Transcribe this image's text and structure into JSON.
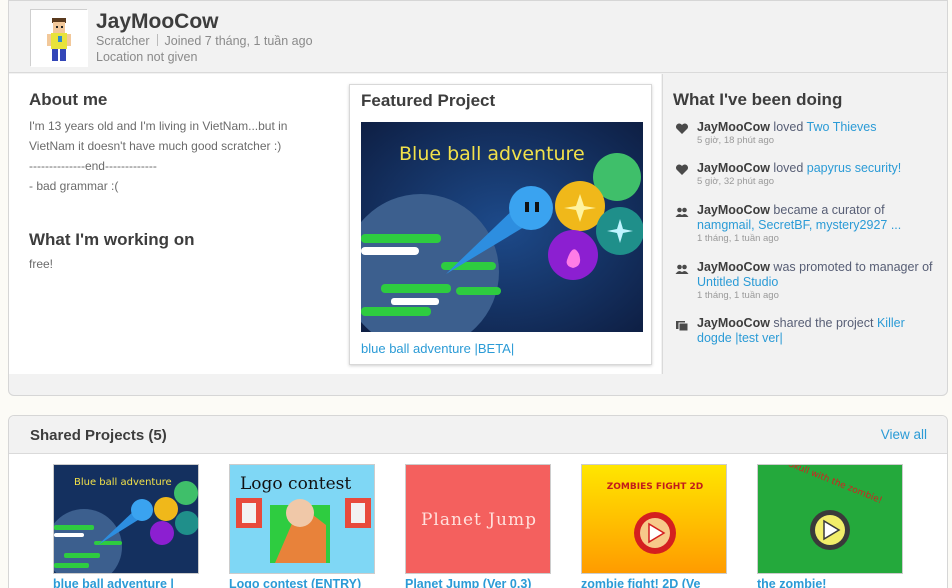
{
  "profile": {
    "username": "JayMooCow",
    "role": "Scratcher",
    "joined": "Joined 7 tháng, 1 tuần ago",
    "location": "Location not given"
  },
  "about": {
    "title": "About me",
    "lines": [
      "I'm 13 years old and I'm living in VietNam...but in",
      "VietNam it doesn't have much good scratcher :)",
      "--------------end-------------",
      "- bad grammar :("
    ]
  },
  "working": {
    "title": "What I'm working on",
    "text": "free!"
  },
  "featured": {
    "title": "Featured Project",
    "thumb_caption": "Blue ball adventure",
    "link": "blue ball adventure |BETA|"
  },
  "activity": {
    "title": "What I've been doing",
    "items": [
      {
        "icon": "heart-icon",
        "user": "JayMooCow",
        "action": " loved ",
        "targets": "Two Thieves",
        "time": "5 giờ, 18 phút ago"
      },
      {
        "icon": "heart-icon",
        "user": "JayMooCow",
        "action": " loved ",
        "targets": "papyrus security!",
        "time": "5 giờ, 32 phút ago"
      },
      {
        "icon": "users-icon",
        "user": "JayMooCow",
        "action": " became a curator of ",
        "targets": "namgmail, SecretBF, mystery2927 ...",
        "time": "1 tháng, 1 tuần ago"
      },
      {
        "icon": "users-icon",
        "user": "JayMooCow",
        "action": " was promoted to manager of ",
        "targets": "Untitled Studio",
        "time": "1 tháng, 1 tuần ago"
      },
      {
        "icon": "share-icon",
        "user": "JayMooCow",
        "action": " shared the project ",
        "targets": "Killer dogde |test ver|",
        "time": ""
      }
    ]
  },
  "shared": {
    "title": "Shared Projects (5)",
    "view_all": "View all",
    "projects": [
      {
        "title": "blue ball adventure |",
        "thumb_text": "Blue ball adventure"
      },
      {
        "title": "Logo contest (ENTRY)",
        "thumb_text": "Logo contest"
      },
      {
        "title": "Planet Jump (Ver 0.3)",
        "thumb_text": "Planet Jump"
      },
      {
        "title": "zombie fight! 2D (Ve",
        "thumb_text": "ZOMBIES FIGHT 2D"
      },
      {
        "title": "the zombie!",
        "thumb_text": "Skull with the zombie!"
      }
    ]
  },
  "colors": {
    "link": "#2b9bd6",
    "panel": "#f2f2f2",
    "title": "#3d3d3d"
  }
}
